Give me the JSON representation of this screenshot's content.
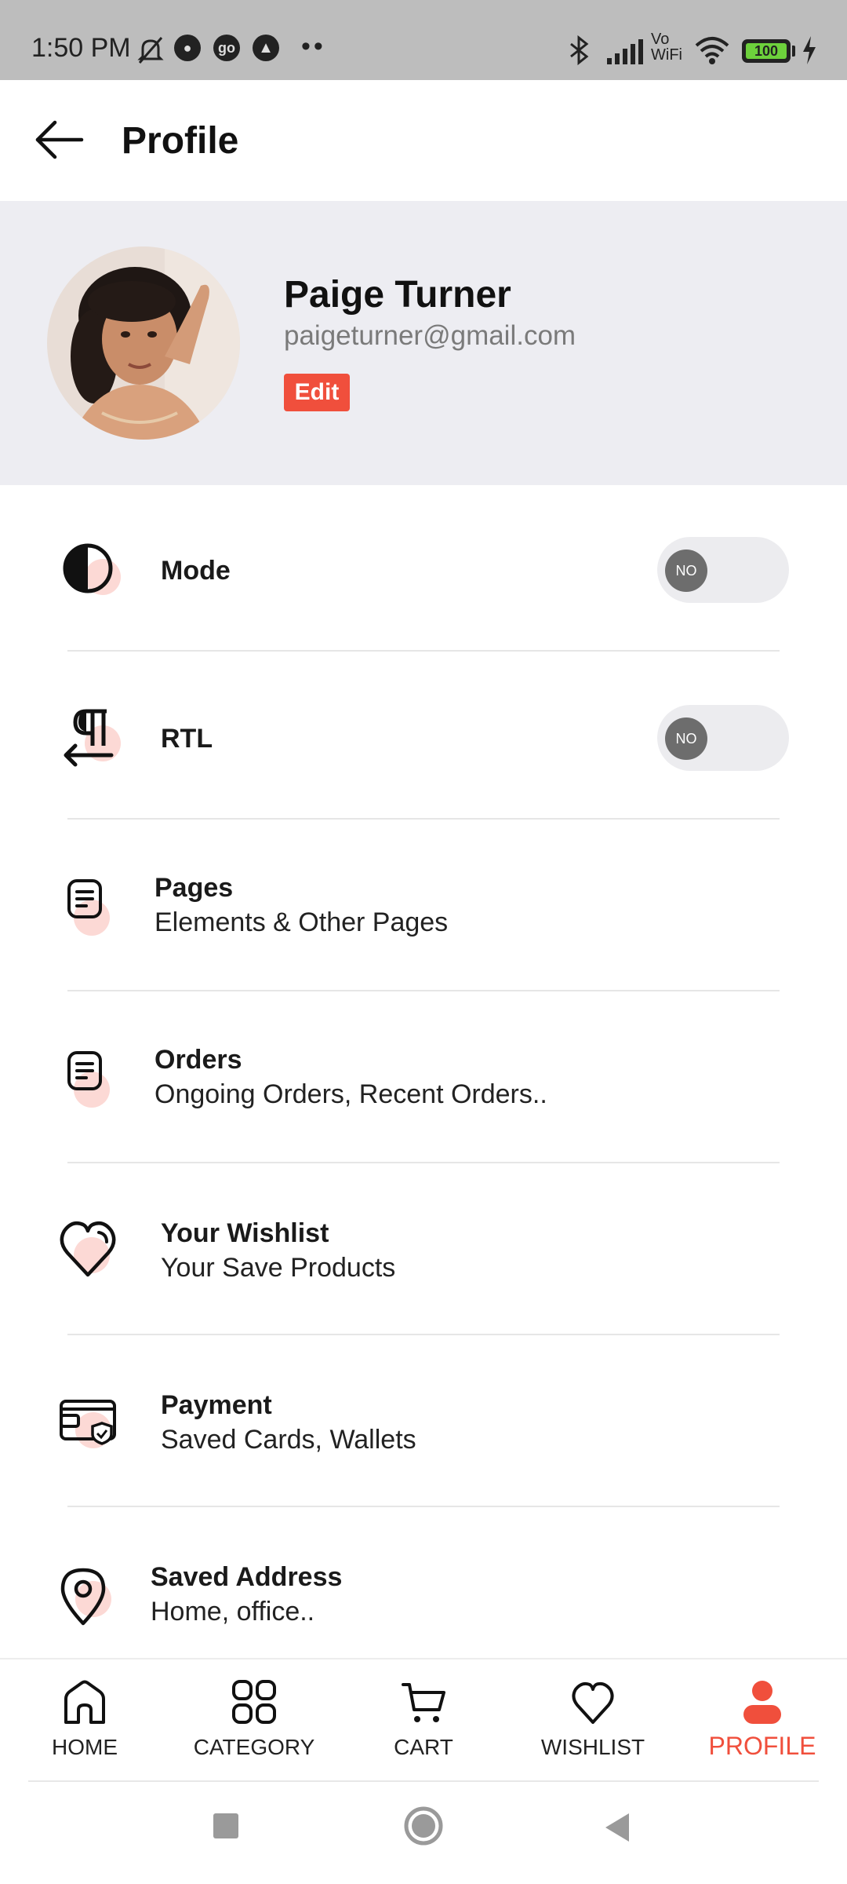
{
  "status_bar": {
    "time": "1:50 PM",
    "icons": [
      "mute-bell-icon",
      "app-badge-icon",
      "go-app-icon",
      "account-icon",
      "more-dots-icon",
      "bluetooth-icon",
      "signal-icon",
      "vowifi-icon",
      "wifi-icon",
      "battery-icon",
      "charging-icon"
    ],
    "vo_label": "Vo",
    "wifi_label": "WiFi",
    "battery": "100",
    "more": "••"
  },
  "header": {
    "title": "Profile",
    "back_icon": "arrow-left-icon"
  },
  "profile": {
    "name": "Paige Turner",
    "email": "paigeturner@gmail.com",
    "edit_label": "Edit"
  },
  "menu": {
    "mode": {
      "label": "Mode",
      "toggle": "NO",
      "icon": "contrast-icon"
    },
    "rtl": {
      "label": "RTL",
      "toggle": "NO",
      "icon": "pilcrow-rtl-icon"
    },
    "items": [
      {
        "title": "Pages",
        "subtitle": "Elements & Other Pages",
        "icon": "document-icon"
      },
      {
        "title": "Orders",
        "subtitle": "Ongoing Orders, Recent Orders..",
        "icon": "document-icon"
      },
      {
        "title": "Your Wishlist",
        "subtitle": "Your Save Products",
        "icon": "heart-icon"
      },
      {
        "title": "Payment",
        "subtitle": "Saved Cards, Wallets",
        "icon": "wallet-shield-icon"
      },
      {
        "title": "Saved Address",
        "subtitle": "Home, office..",
        "icon": "map-pin-icon"
      }
    ]
  },
  "bottom_nav": {
    "items": [
      {
        "label": "HOME",
        "icon": "home-icon"
      },
      {
        "label": "CATEGORY",
        "icon": "grid-icon"
      },
      {
        "label": "CART",
        "icon": "cart-icon"
      },
      {
        "label": "WISHLIST",
        "icon": "heart-icon"
      },
      {
        "label": "PROFILE",
        "icon": "user-icon",
        "active": true
      }
    ]
  },
  "colors": {
    "accent": "#f04f3c",
    "accent_soft": "#fcd9d5",
    "profile_bg": "#ededf2",
    "status_bar_bg": "#bdbdbd"
  }
}
